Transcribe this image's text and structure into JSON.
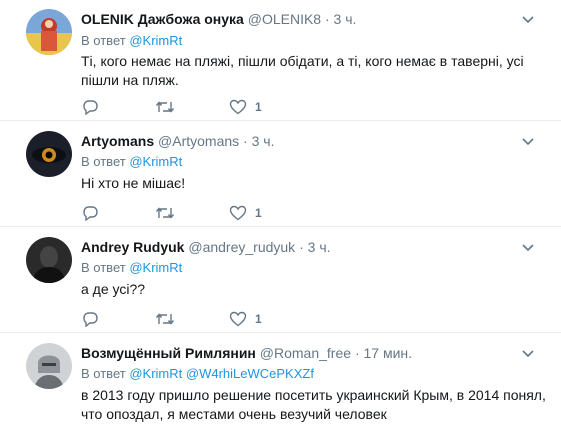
{
  "tweets": [
    {
      "fullname": "OLENIK Дажбожа онука",
      "screenname": "@OLENIK8",
      "time": "3 ч.",
      "reply_prefix": "В ответ",
      "reply_to": "@KrimRt",
      "text": "Ті, кого немає на пляжі, пішли обідати, а ті, кого немає в таверні, усі пішли на пляж.",
      "likes": "1"
    },
    {
      "fullname": "Artyomans",
      "screenname": "@Artyomans",
      "time": "3 ч.",
      "reply_prefix": "В ответ",
      "reply_to": "@KrimRt",
      "text": "Ні хто не мішає!",
      "likes": "1"
    },
    {
      "fullname": "Andrey Rudyuk",
      "screenname": "@andrey_rudyuk",
      "time": "3 ч.",
      "reply_prefix": "В ответ",
      "reply_to": "@KrimRt",
      "text": "а де усі??",
      "likes": "1"
    },
    {
      "fullname": "Возмущённый Римлянин",
      "screenname": "@Roman_free",
      "time": "17 мин.",
      "reply_prefix": "В ответ",
      "reply_to": "@KrimRt",
      "reply_to_2": "@W4rhiLeWCePKXZf",
      "text": "в 2013 году пришло решение посетить украинский Крым, в 2014 понял, что опоздал, я местами очень везучий человек"
    }
  ],
  "separator": "·",
  "colors": {
    "link": "#1b95e0",
    "muted": "#657786",
    "border": "#e6ecf0"
  }
}
